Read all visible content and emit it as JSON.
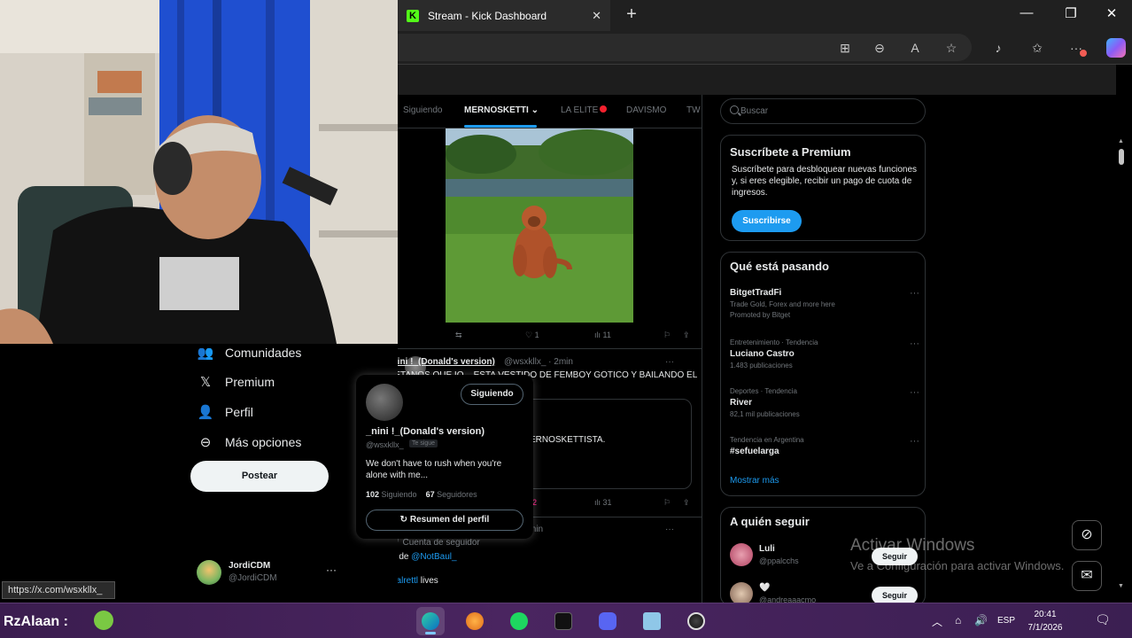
{
  "browser": {
    "tab_title": "Stream - Kick Dashboard",
    "tab_favicon": "K",
    "close_glyph": "✕",
    "new_tab_glyph": "+",
    "window_controls": [
      "—",
      "❐",
      "✕"
    ],
    "toolbar_icons": [
      "split-screen-icon",
      "zoom-out-icon",
      "read-aloud-icon",
      "favorite-star-icon",
      "extensions-icon",
      "favorites-icon",
      "more-icon",
      "copilot-icon"
    ],
    "toolbar_glyphs": [
      "⊞",
      "⊖",
      "A",
      "☆",
      "♪",
      "✩",
      "···"
    ],
    "status_url": "https://x.com/wsxkllx_"
  },
  "nav": {
    "items": [
      {
        "label": "Comunidades",
        "icon": "communities-icon",
        "glyph": "👥"
      },
      {
        "label": "Premium",
        "icon": "x-logo-icon",
        "glyph": "𝕏"
      },
      {
        "label": "Perfil",
        "icon": "profile-icon",
        "glyph": "👤"
      },
      {
        "label": "Más opciones",
        "icon": "more-options-icon",
        "glyph": "⊖"
      }
    ],
    "post_label": "Postear",
    "account": {
      "name": "JordiCDM",
      "handle": "@JordiCDM",
      "more": "···"
    }
  },
  "feed": {
    "tabs": [
      "Siguiendo",
      "MERNOSKETTI",
      "LA ELITE",
      "DAVISMO",
      "TW"
    ],
    "active_tab_suffix": "⌄",
    "post1_actions": {
      "retweet": "⇆",
      "likes": "♡ 1",
      "views": "ılı 11",
      "bookmark": "⚐",
      "share": "⇪"
    },
    "post2": {
      "name": "_nini !_(Donald's version)",
      "handle": "@wsxkllx_ · 2min",
      "text": "METANOS QUE IO... ESTA VESTIDO DE FEMBOY GOTICO Y BAILANDO EL",
      "quote_text": "ERNOSKETTISTA.",
      "views": "ılı 31",
      "reply_count": "2"
    },
    "post3": {
      "line1": "🛡 Cuenta de seguidor",
      "line2_prefix": "IG de ",
      "line2_link": "@NotBaul_",
      "hashtag": "#zalrettl",
      "hashtag_suffix": " lives",
      "time": "min"
    }
  },
  "hovercard": {
    "follow_label": "Siguiendo",
    "name": "_nini !_(Donald's version)",
    "handle": "@wsxkllx_",
    "badge": "Te sigue",
    "bio": "We don't have to rush when you're alone with me...",
    "following_count": "102",
    "following_label": " Siguiendo",
    "followers_count": "67",
    "followers_label": " Seguidores",
    "summary_label": "Resumen del perfil"
  },
  "sidebar": {
    "search_placeholder": "Buscar",
    "premium": {
      "title": "Suscríbete a Premium",
      "desc": "Suscríbete para desbloquear nuevas funciones y, si eres elegible, recibir un pago de cuota de ingresos.",
      "button": "Suscribirse"
    },
    "trends_title": "Qué está pasando",
    "trends": [
      {
        "category": "",
        "name": "BitgetTradFi",
        "count": "Trade Gold, Forex and more here",
        "extra": "Promoted by Bitget"
      },
      {
        "category": "Entretenimiento · Tendencia",
        "name": "Luciano Castro",
        "count": "1.483 publicaciones",
        "extra": ""
      },
      {
        "category": "Deportes · Tendencia",
        "name": "River",
        "count": "82,1 mil publicaciones",
        "extra": ""
      },
      {
        "category": "Tendencia en Argentina",
        "name": "#sefuelarga",
        "count": "",
        "extra": ""
      }
    ],
    "show_more": "Mostrar más",
    "who_title": "A quién seguir",
    "who": [
      {
        "name": "Luli",
        "handle": "@ppalcchs",
        "follow": "Seguir"
      },
      {
        "name": "🤍",
        "handle": "@andreaaacmo",
        "follow": "Seguir"
      }
    ]
  },
  "watermark": {
    "line1": "Activar Windows",
    "line2": "Ve a Configuración para activar Windows."
  },
  "taskbar": {
    "user": "RzAlaan :",
    "apps": [
      "edge-icon",
      "fl-studio-icon",
      "spotify-icon",
      "x-app-icon",
      "discord-icon",
      "notepad-icon",
      "obs-icon"
    ],
    "tray_chevron": "︿",
    "language": "ESP",
    "time": "20:41",
    "date": "7/1/2026"
  },
  "colors": {
    "accent": "#1d9bf0",
    "kick_green": "#53fc18",
    "taskbar": "#4a2560"
  }
}
